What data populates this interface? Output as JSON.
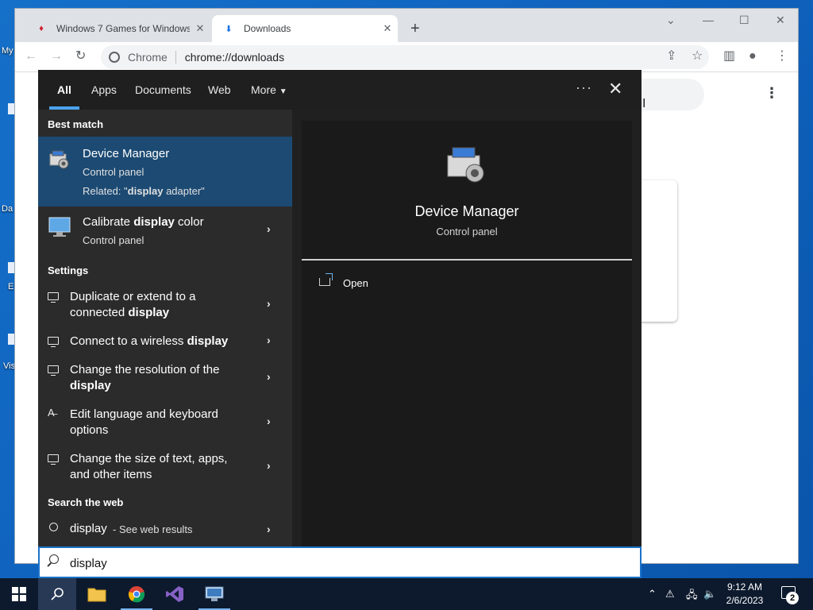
{
  "desktop": {
    "labels": [
      "My",
      "Da",
      "E",
      "Vis"
    ]
  },
  "chrome": {
    "tabs": [
      {
        "title": "Windows 7 Games for Windows",
        "active": false
      },
      {
        "title": "Downloads",
        "active": true
      }
    ],
    "omnibox": {
      "chip": "Chrome",
      "url": "chrome://downloads"
    }
  },
  "search_panel": {
    "tabs": [
      "All",
      "Apps",
      "Documents",
      "Web",
      "More"
    ],
    "sections": {
      "best_match": "Best match",
      "settings": "Settings",
      "search_web": "Search the web"
    },
    "best_match": {
      "title": "Device Manager",
      "subtitle": "Control panel",
      "related_prefix": "Related: \"",
      "related_term": "display",
      "related_suffix": " adapter\""
    },
    "apps": [
      {
        "title_pre": "Calibrate ",
        "title_bold": "display",
        "title_post": " color",
        "subtitle": "Control panel"
      }
    ],
    "settings": [
      {
        "line1": "Duplicate or extend to a",
        "line2_pre": "connected ",
        "line2_bold": "display"
      },
      {
        "line1_pre": "Connect to a wireless ",
        "line1_bold": "display"
      },
      {
        "line1": "Change the resolution of the",
        "line2_bold": "display"
      },
      {
        "line1": "Edit language and keyboard",
        "line2": "options"
      },
      {
        "line1": "Change the size of text, apps,",
        "line2": "and other items"
      }
    ],
    "web": {
      "query": "display",
      "suffix": " - See web results"
    },
    "preview": {
      "title": "Device Manager",
      "subtitle": "Control panel",
      "actions": [
        "Open"
      ]
    }
  },
  "search_box": {
    "value": "display "
  },
  "taskbar": {
    "time": "9:12 AM",
    "date": "2/6/2023",
    "notifications": "2"
  },
  "colors": {
    "accent": "#1c4a73",
    "tab_underline": "#4ba3f0"
  }
}
